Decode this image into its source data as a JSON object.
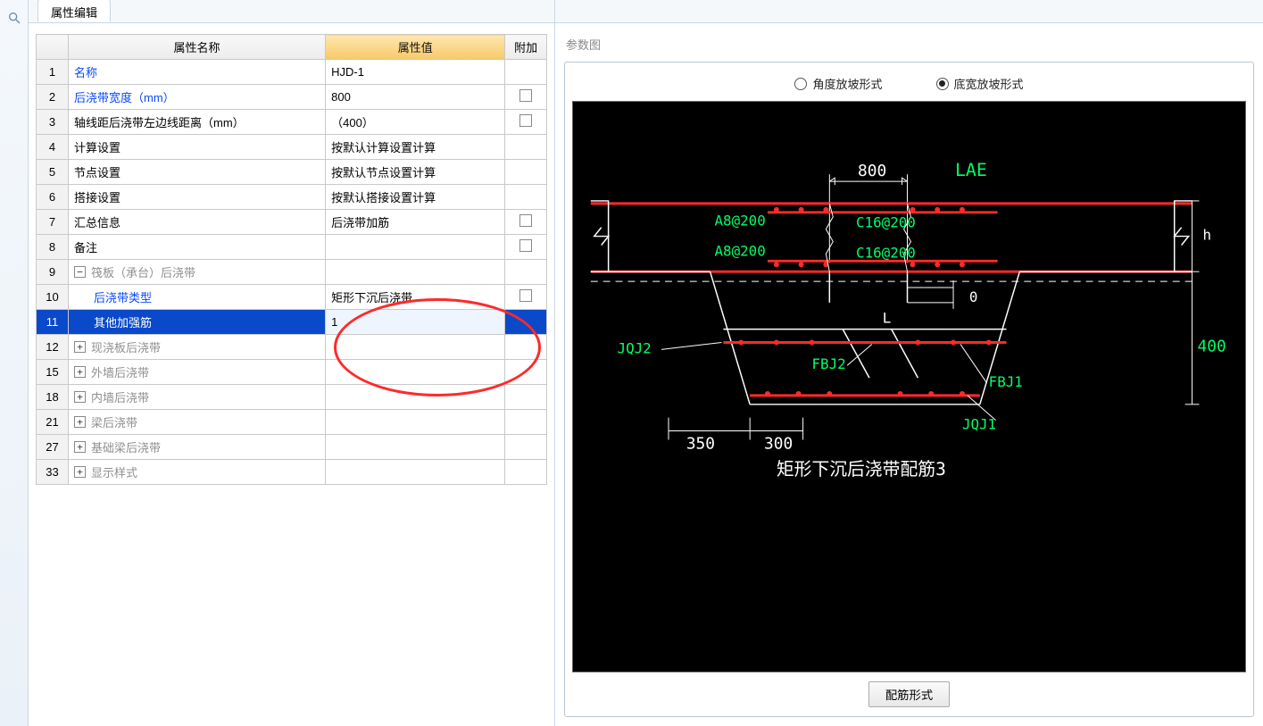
{
  "leftRail": {
    "tools": [
      {
        "name": "search-icon"
      }
    ]
  },
  "tab": "属性编辑",
  "grid": {
    "headers": {
      "name": "属性名称",
      "value": "属性值",
      "addon": "附加"
    },
    "rows": [
      {
        "n": "1",
        "name": "名称",
        "value": "HJD-1",
        "link": true,
        "addon": ""
      },
      {
        "n": "2",
        "name": "后浇带宽度（mm）",
        "value": "800",
        "link": true,
        "addon": "chk"
      },
      {
        "n": "3",
        "name": "轴线距后浇带左边线距离（mm）",
        "value": "（400）",
        "addon": "chk"
      },
      {
        "n": "4",
        "name": "计算设置",
        "value": "按默认计算设置计算"
      },
      {
        "n": "5",
        "name": "节点设置",
        "value": "按默认节点设置计算"
      },
      {
        "n": "6",
        "name": "搭接设置",
        "value": "按默认搭接设置计算"
      },
      {
        "n": "7",
        "name": "汇总信息",
        "value": "后浇带加筋",
        "addon": "chk"
      },
      {
        "n": "8",
        "name": "备注",
        "value": "",
        "addon": "chk"
      },
      {
        "n": "9",
        "name": "筏板（承台）后浇带",
        "value": "",
        "group": true,
        "state": "-",
        "grey": true
      },
      {
        "n": "10",
        "name": "后浇带类型",
        "value": "矩形下沉后浇带",
        "child": true,
        "link": true,
        "addon": "chk"
      },
      {
        "n": "11",
        "name": "其他加强筋",
        "value": "1",
        "child": true,
        "selected": true
      },
      {
        "n": "12",
        "name": "现浇板后浇带",
        "value": "",
        "group": true,
        "state": "+",
        "grey": true
      },
      {
        "n": "15",
        "name": "外墙后浇带",
        "value": "",
        "group": true,
        "state": "+",
        "grey": true
      },
      {
        "n": "18",
        "name": "内墙后浇带",
        "value": "",
        "group": true,
        "state": "+",
        "grey": true
      },
      {
        "n": "21",
        "name": "梁后浇带",
        "value": "",
        "group": true,
        "state": "+",
        "grey": true
      },
      {
        "n": "27",
        "name": "基础梁后浇带",
        "value": "",
        "group": true,
        "state": "+",
        "grey": true
      },
      {
        "n": "33",
        "name": "显示样式",
        "value": "",
        "group": true,
        "state": "+",
        "grey": true
      }
    ]
  },
  "right": {
    "title": "参数图",
    "radios": [
      {
        "label": "角度放坡形式",
        "selected": false
      },
      {
        "label": "底宽放坡形式",
        "selected": true
      }
    ],
    "button": "配筋形式",
    "diagram": {
      "title": "矩形下沉后浇带配筋3",
      "dims": {
        "top": "800",
        "lae": "LAE",
        "right_h": "h",
        "right_400": "400",
        "bot_350": "350",
        "bot_300": "300",
        "zero": "0",
        "L": "L"
      },
      "labels": {
        "a8_1": "A8@200",
        "a8_2": "A8@200",
        "c16_1": "C16@200",
        "c16_2": "C16@200",
        "jqj2": "JQJ2",
        "fbj2": "FBJ2",
        "fbj1": "FBJ1",
        "jqj1": "JQJ1"
      }
    }
  }
}
